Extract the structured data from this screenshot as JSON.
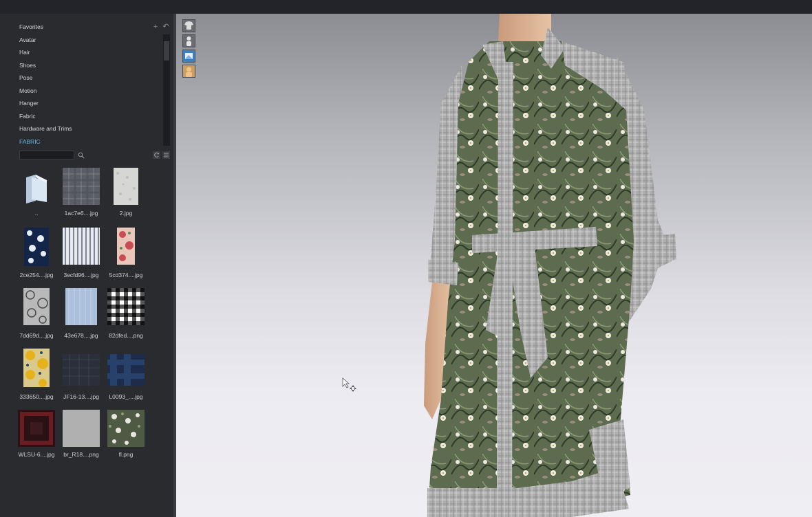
{
  "library": {
    "tree_items": [
      "Favorites",
      "Avatar",
      "Hair",
      "Shoes",
      "Pose",
      "Motion",
      "Hanger",
      "Fabric",
      "Hardware and Trims",
      "FABRIC"
    ],
    "active_item": "FABRIC",
    "search_placeholder": "",
    "files": [
      {
        "name": "..",
        "type": "folder-up"
      },
      {
        "name": "1ac7e6....jpg",
        "type": "fabric-swatch"
      },
      {
        "name": "2.jpg",
        "type": "fabric-swatch"
      },
      {
        "name": "2ce254....jpg",
        "type": "fabric-swatch"
      },
      {
        "name": "3ecfd96....jpg",
        "type": "fabric-swatch"
      },
      {
        "name": "5cd374....jpg",
        "type": "fabric-swatch"
      },
      {
        "name": "7dd69d....jpg",
        "type": "fabric-swatch"
      },
      {
        "name": "43e678....jpg",
        "type": "fabric-swatch"
      },
      {
        "name": "82dfed....png",
        "type": "fabric-swatch"
      },
      {
        "name": "333650....jpg",
        "type": "fabric-swatch"
      },
      {
        "name": "JF16-13....jpg",
        "type": "fabric-swatch"
      },
      {
        "name": "L0093_....jpg",
        "type": "fabric-swatch"
      },
      {
        "name": "WLSU-6....jpg",
        "type": "fabric-swatch"
      },
      {
        "name": "br_R18....png",
        "type": "fabric-swatch"
      },
      {
        "name": "fl.png",
        "type": "fabric-swatch"
      }
    ]
  },
  "viewport": {
    "tools": [
      "cloth-display-icon",
      "avatar-display-icon",
      "texture-display-icon",
      "skin-display-icon"
    ],
    "scene": "3D avatar wearing floral shirt dress with glen-check trim and belt"
  },
  "colors": {
    "accent": "#6fb3e8",
    "panel": "#2a2b2f"
  }
}
